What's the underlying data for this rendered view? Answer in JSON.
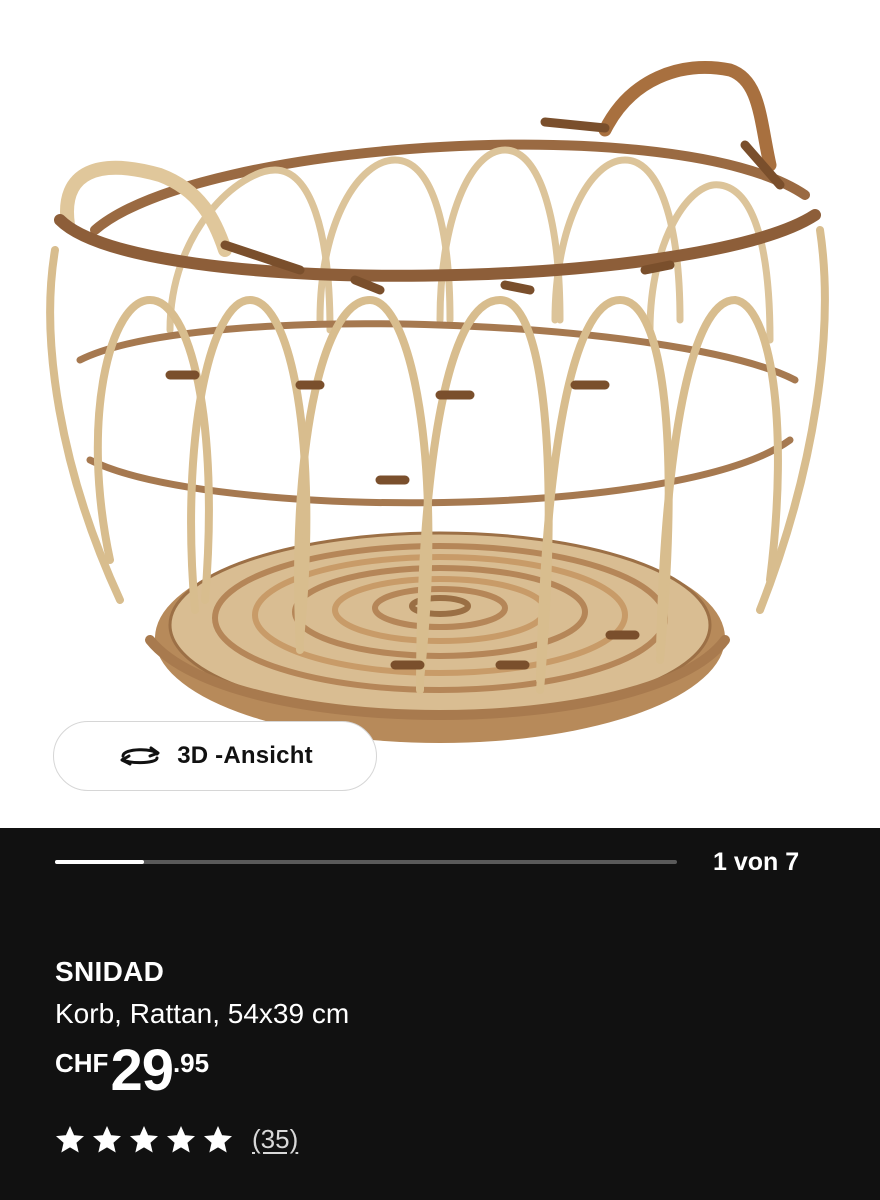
{
  "product_image": {
    "alt": "SNIDAD Korb, Rattan"
  },
  "view3d": {
    "label": "3D -Ansicht",
    "icon": "rotate-3d-icon"
  },
  "carousel": {
    "counter": "1 von 7",
    "current": 1,
    "total": 7
  },
  "product": {
    "name": "SNIDAD",
    "description": "Korb, Rattan, 54x39 cm",
    "price": {
      "currency": "CHF",
      "integer": "29",
      "decimal": ".95"
    },
    "rating": {
      "stars": 5,
      "max": 5,
      "count": "(35)"
    }
  },
  "colors": {
    "background_dark": "#111111",
    "text": "#ffffff",
    "accent_track": "#5a5a5a"
  }
}
